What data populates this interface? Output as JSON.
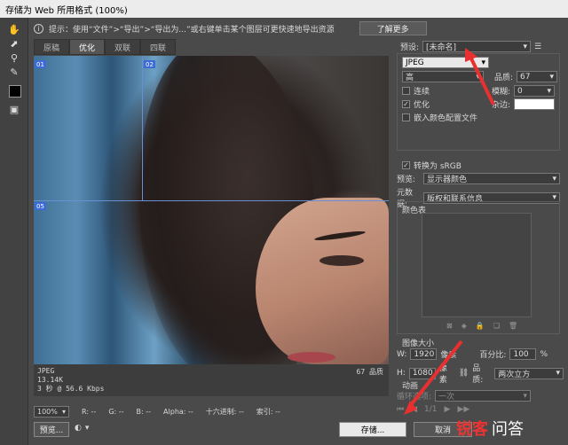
{
  "window": {
    "title": "存储为 Web 所用格式 (100%)"
  },
  "infobar": {
    "text": "提示：使用“文件”>“导出”>“导出为...”或右键单击某个图层可更快速地导出资源",
    "more_label": "了解更多"
  },
  "tabs": [
    {
      "label": "原稿"
    },
    {
      "label": "优化"
    },
    {
      "label": "双联"
    },
    {
      "label": "四联"
    }
  ],
  "slices": [
    "01",
    "02",
    "05"
  ],
  "preview_info": {
    "format": "JPEG",
    "size": "13.14K",
    "speed": "3 秒 @ 56.6 Kbps",
    "quality": "67 品质"
  },
  "statusbar": {
    "zoom": "100%",
    "r": "R: --",
    "g": "G: --",
    "b": "B: --",
    "alpha": "Alpha: --",
    "hex": "十六进制: --",
    "index": "索引: --"
  },
  "settings": {
    "preset_label": "预设:",
    "preset_value": "[未命名]",
    "format": "JPEG",
    "quality_level": "高",
    "quality_label": "品质:",
    "quality_value": "67",
    "progressive_label": "连续",
    "blur_label": "模糊:",
    "blur_value": "0",
    "optimized_label": "优化",
    "matte_label": "杂边:",
    "embed_profile_label": "嵌入颜色配置文件",
    "convert_srgb_label": "转换为 sRGB",
    "preview_label": "预览:",
    "preview_value": "显示器颜色",
    "metadata_label": "元数据:",
    "metadata_value": "版权和联系信息",
    "color_table_label": "颜色表",
    "image_size_label": "图像大小",
    "w_label": "W:",
    "w_value": "1920",
    "h_label": "H:",
    "h_value": "1080",
    "unit": "像素",
    "percent_label": "百分比:",
    "percent_value": "100",
    "percent_unit": "%",
    "resample_label": "品质:",
    "resample_value": "两次立方",
    "animation_label": "动画",
    "loop_label": "循环选项:",
    "loop_value": "一次",
    "frame_counter": "1/1"
  },
  "buttons": {
    "preview": "预览...",
    "save": "存储...",
    "cancel": "取消"
  },
  "watermark": {
    "brand": "锐客",
    "suffix": "问答"
  },
  "colors": {
    "accent_slice": "#3c6ad6",
    "annotation_arrow": "#e83030"
  }
}
